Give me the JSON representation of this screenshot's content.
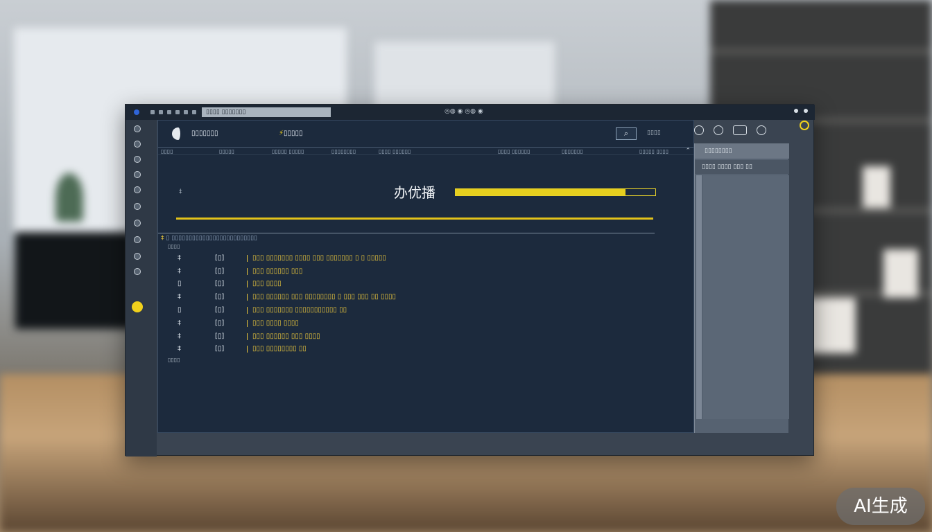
{
  "titlebar": {
    "address_text": "▯▯▯▯ ▯▯▯▯▯▯▯",
    "center_text": "◎◍ ◉ ◎◍ ◉"
  },
  "header": {
    "brand": "▯▯▯▯▯▯▯",
    "link": "▯▯▯▯▯",
    "search_icon": "search-icon",
    "extra": "▯▯▯▯"
  },
  "columns": [
    "▯▯▯▯",
    "▯▯▯▯▯",
    "▯▯▯▯▯ ▯▯▯▯▯",
    "▯▯▯▯▯▯▯▯",
    "▯▯▯▯ ▯▯▯▯▯▯",
    "▯▯▯▯ ▯▯▯▯▯▯",
    "▯▯▯▯▯▯▯",
    "▯▯▯▯▯ ▯▯▯▯"
  ],
  "banner": {
    "title": "办优播",
    "small": "‡",
    "progress": 0.85
  },
  "path": "▯ ▯▯▯▯▯▯▯▯▯▯▯▯▯▯▯▯▯▯▯▯▯▯▯▯▯",
  "path_label": "▯▯▯▯",
  "rows": [
    {
      "num": "‡",
      "code": "[▯]",
      "text": "▯▯▯ ▯▯▯▯▯▯▯ ▯▯▯▯ ▯▯▯ ▯▯▯▯▯▯▯ ▯ ▯ ▯▯▯▯▯"
    },
    {
      "num": "‡",
      "code": "[▯]",
      "text": "▯▯▯ ▯▯▯▯▯▯ ▯▯▯"
    },
    {
      "num": "▯",
      "code": "[▯]",
      "text": "▯▯▯ ▯▯▯▯"
    },
    {
      "num": "‡",
      "code": "[▯]",
      "text": "▯▯▯ ▯▯▯▯▯▯  ▯▯▯ ▯▯▯▯▯▯▯▯  ▯ ▯▯▯ ▯▯▯ ▯▯ ▯▯▯▯"
    },
    {
      "num": "▯",
      "code": "[▯]",
      "text": "▯▯▯ ▯▯▯▯▯▯▯  ▯▯▯▯▯▯▯▯▯▯▯ ▯▯"
    },
    {
      "num": "‡",
      "code": "[▯]",
      "text": "▯▯▯ ▯▯▯▯ ▯▯▯▯"
    },
    {
      "num": "‡",
      "code": "[▯]",
      "text": "▯▯▯ ▯▯▯▯▯▯  ▯▯▯ ▯▯▯▯"
    },
    {
      "num": "‡",
      "code": "[▯]",
      "text": "▯▯▯ ▯▯▯▯▯▯▯▯ ▯▯"
    }
  ],
  "footer_label": "▯▯▯▯",
  "side": {
    "head": "▯▯▯▯▯▯▯▯",
    "row": "▯▯▯▯ ▯▯▯▯ ▯▯▯ ▯▯"
  },
  "watermark": "AI生成",
  "colors": {
    "accent": "#f1d11c",
    "panel": "#1c2a3d",
    "text_yellow": "#e8c53c",
    "text_blue": "#7fb0ee"
  }
}
